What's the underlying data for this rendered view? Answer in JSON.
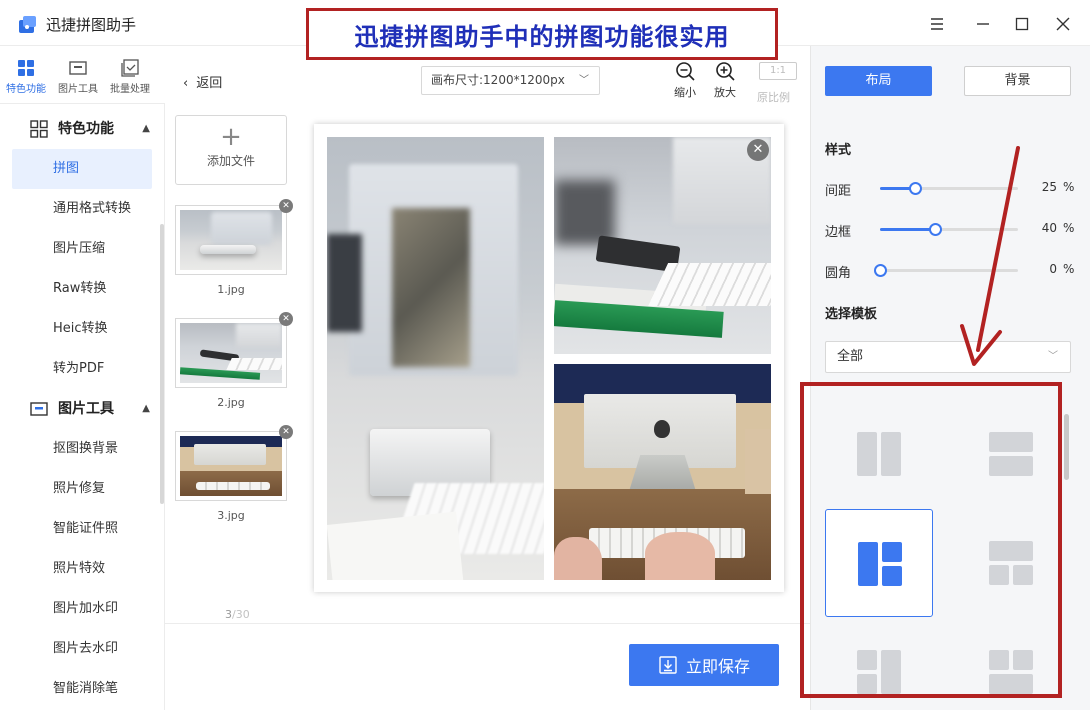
{
  "app": {
    "name": "迅捷拼图助手"
  },
  "banner": {
    "text": "迅捷拼图助手中的拼图功能很实用"
  },
  "mode_tabs": [
    {
      "label": "特色功能",
      "icon": "grid-icon"
    },
    {
      "label": "图片工具",
      "icon": "image-tool-icon"
    },
    {
      "label": "批量处理",
      "icon": "batch-icon"
    }
  ],
  "sidebar": {
    "section1": {
      "title": "特色功能",
      "icon": "grid-icon"
    },
    "items1": [
      "拼图",
      "通用格式转换",
      "图片压缩",
      "Raw转换",
      "Heic转换",
      "转为PDF"
    ],
    "section2": {
      "title": "图片工具",
      "icon": "image-tool-icon"
    },
    "items2": [
      "抠图换背景",
      "照片修复",
      "智能证件照",
      "照片特效",
      "图片加水印",
      "图片去水印",
      "智能消除笔"
    ]
  },
  "files": {
    "back_label": "返回",
    "add_label": "添加文件",
    "items": [
      "1.jpg",
      "2.jpg",
      "3.jpg"
    ],
    "count_current": "3",
    "count_total": "/30"
  },
  "toolbar": {
    "canvas_size": "画布尺寸:1200*1200px",
    "zoom_out": "缩小",
    "zoom_in": "放大",
    "ratio_badge": "1:1",
    "ratio_label": "原比例"
  },
  "save": {
    "label": "立即保存"
  },
  "right": {
    "tab_layout": "布局",
    "tab_background": "背景",
    "style_heading": "样式",
    "sliders": [
      {
        "label": "间距",
        "value": "25",
        "unit": "%",
        "fraction": 0.25
      },
      {
        "label": "边框",
        "value": "40",
        "unit": "%",
        "fraction": 0.4
      },
      {
        "label": "圆角",
        "value": "0",
        "unit": "%",
        "fraction": 0
      }
    ],
    "template_heading": "选择模板",
    "template_filter": "全部"
  },
  "colors": {
    "accent": "#3c78f0",
    "annotation": "#b22222",
    "banner_text": "#1f2fb8"
  }
}
